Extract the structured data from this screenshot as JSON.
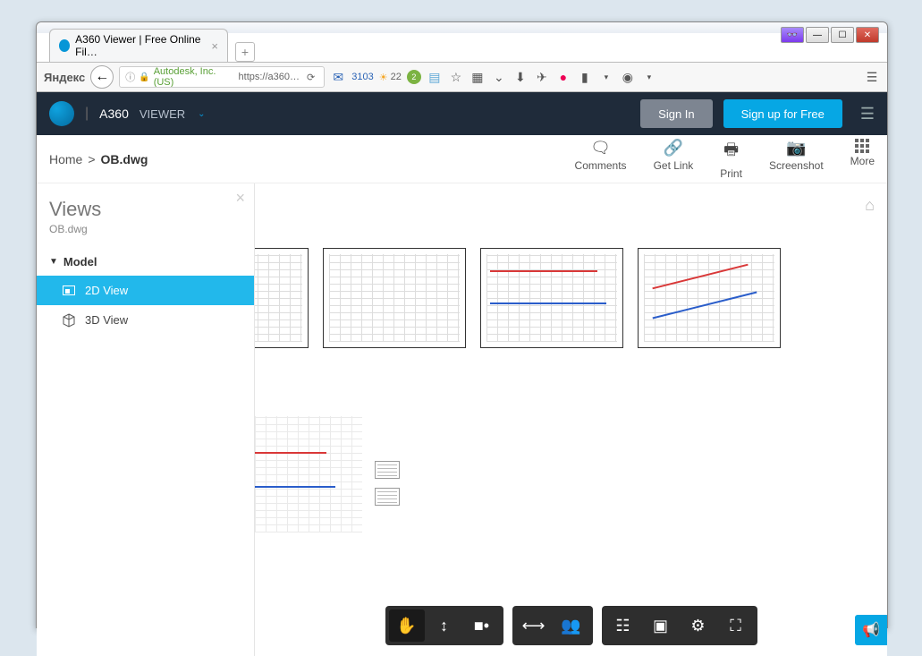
{
  "browser": {
    "tab_title": "A360 Viewer | Free Online Fil…",
    "search_engine": "Яндекс",
    "url_host": "Autodesk, Inc. (US)",
    "url_path": "https://a360…",
    "mail_count": "3103",
    "weather_temp": "22",
    "green_badge": "2"
  },
  "app": {
    "brand": "A360",
    "section": "VIEWER",
    "signin": "Sign In",
    "signup": "Sign up for Free"
  },
  "breadcrumb": {
    "home": "Home",
    "sep": ">",
    "current": "OB.dwg"
  },
  "toolbar": {
    "comments": "Comments",
    "getlink": "Get Link",
    "print": "Print",
    "screenshot": "Screenshot",
    "more": "More"
  },
  "panel": {
    "title": "Views",
    "subtitle": "OB.dwg",
    "group": "Model",
    "view_2d": "2D View",
    "view_3d": "3D View"
  }
}
